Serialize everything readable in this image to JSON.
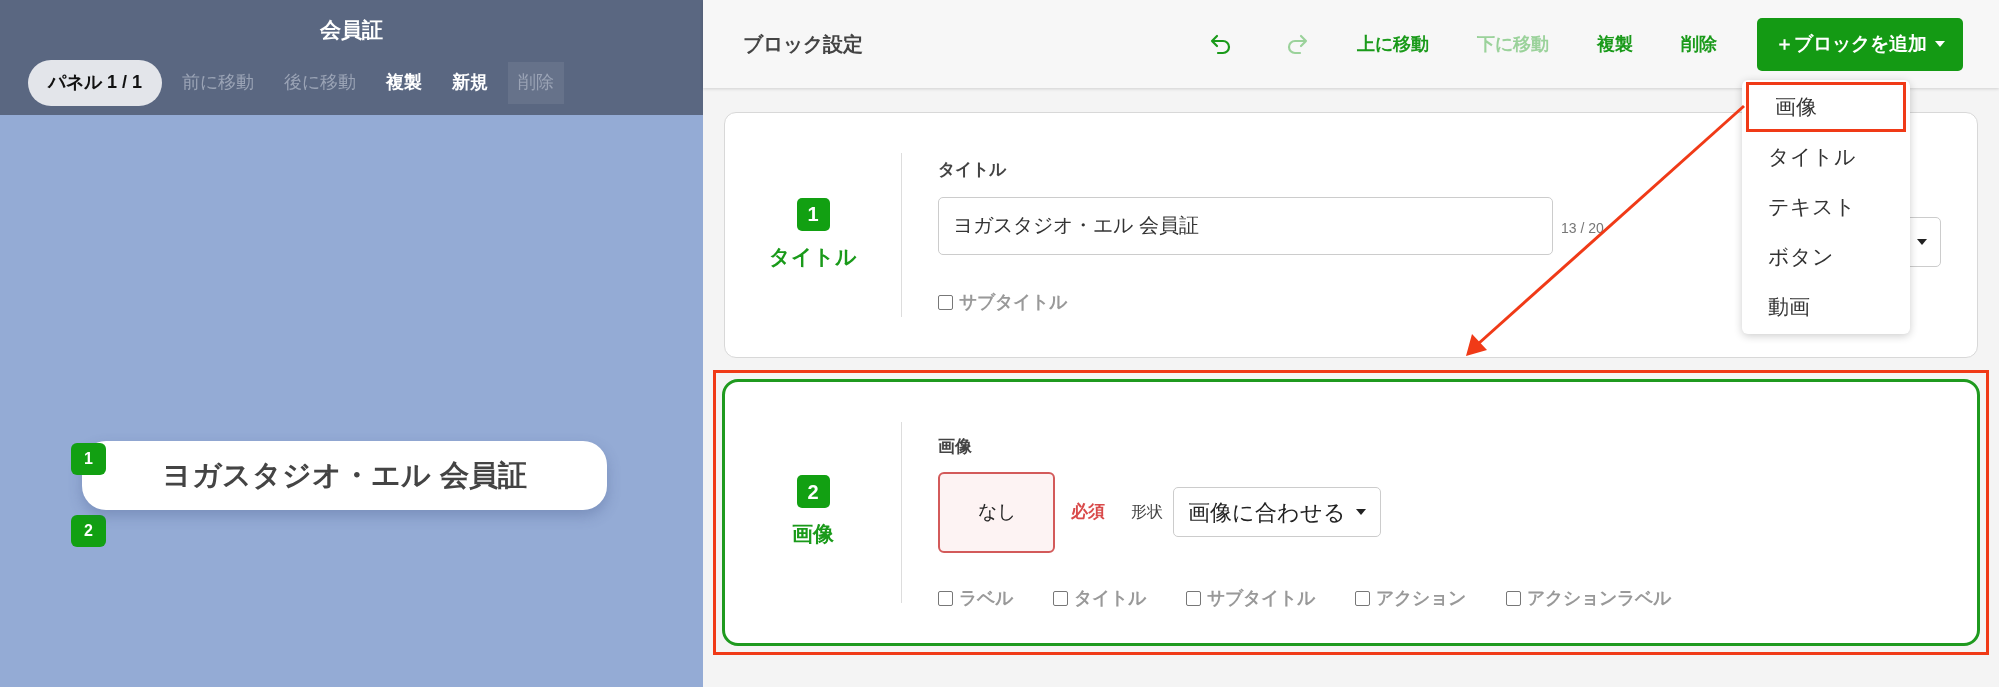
{
  "left_panel": {
    "title": "会員証",
    "toolbar": [
      {
        "kind": "pill",
        "label": "パネル 1 / 1"
      },
      {
        "kind": "text",
        "label": "前に移動",
        "disabled": true
      },
      {
        "kind": "text",
        "label": "後に移動",
        "disabled": true
      },
      {
        "kind": "text",
        "label": "複製",
        "disabled": false
      },
      {
        "kind": "text",
        "label": "新規",
        "disabled": false
      },
      {
        "kind": "text",
        "label": "削除",
        "disabled": true
      }
    ],
    "preview": [
      {
        "number": "1",
        "text": "ヨガスタジオ・エル 会員証"
      },
      {
        "number": "2"
      }
    ]
  },
  "right_panel": {
    "title": "ブロック設定",
    "toolbar": [
      {
        "kind": "undo",
        "disabled": false
      },
      {
        "kind": "redo",
        "disabled": true
      },
      {
        "kind": "text",
        "label": "上に移動",
        "disabled": false
      },
      {
        "kind": "text",
        "label": "下に移動",
        "disabled": true
      },
      {
        "kind": "text",
        "label": "複製",
        "disabled": false
      },
      {
        "kind": "text",
        "label": "削除",
        "disabled": false
      }
    ],
    "add_button": {
      "label": "＋ブロックを追加",
      "expanded": true
    },
    "add_menu": [
      {
        "label": "画像",
        "highlighted": true
      },
      {
        "label": "タイトル",
        "highlighted": false
      },
      {
        "label": "テキスト",
        "highlighted": false
      },
      {
        "label": "ボタン",
        "highlighted": false
      },
      {
        "label": "動画",
        "highlighted": false
      }
    ],
    "blocks": [
      {
        "kind": "title",
        "number": "1",
        "type_label": "タイトル",
        "selected": false,
        "highlighted": false,
        "field_label": "タイトル",
        "value": "ヨガスタジオ・エル 会員証",
        "counter": "13 / 20",
        "options": [
          {
            "label": "サブタイトル",
            "checked": false
          }
        ]
      },
      {
        "kind": "image",
        "number": "2",
        "type_label": "画像",
        "selected": true,
        "highlighted": true,
        "field_label": "画像",
        "image_button": "なし",
        "required": "必須",
        "shape_label": "形状",
        "shape_value": "画像に合わせる",
        "options": [
          {
            "label": "ラベル",
            "checked": false
          },
          {
            "label": "タイトル",
            "checked": false
          },
          {
            "label": "サブタイトル",
            "checked": false
          },
          {
            "label": "アクション",
            "checked": false
          },
          {
            "label": "アクションラベル",
            "checked": false
          }
        ]
      }
    ]
  }
}
